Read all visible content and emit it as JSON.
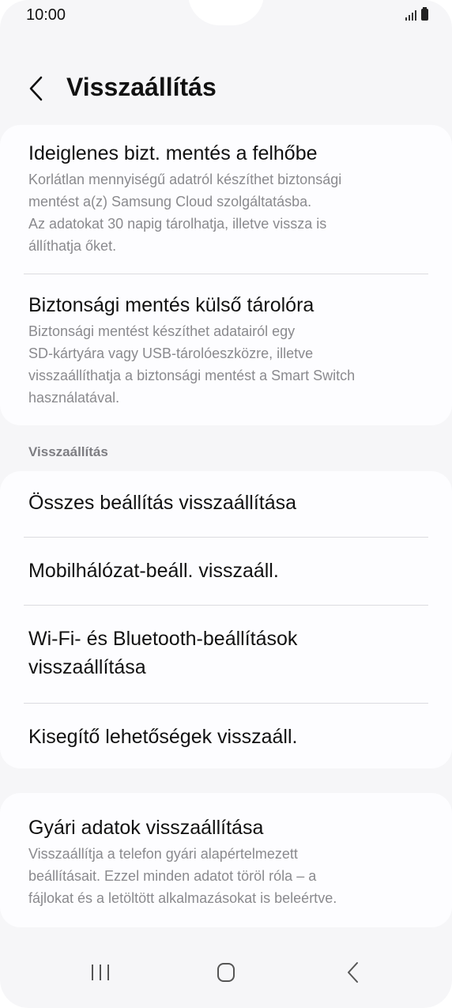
{
  "status_bar": {
    "time": "10:00"
  },
  "header": {
    "title": "Visszaállítás"
  },
  "backup_card": {
    "items": [
      {
        "title": "Ideiglenes bizt. mentés a felhőbe",
        "description_lines": [
          "Korlátlan mennyiségű adatról készíthet biztonsági",
          "mentést a(z) Samsung Cloud szolgáltatásba.",
          "Az adatokat 30 napig tárolhatja, illetve vissza is",
          "állíthatja őket."
        ]
      },
      {
        "title": "Biztonsági mentés külső tárolóra",
        "description_lines": [
          "Biztonsági mentést készíthet adatairól egy",
          "SD-kártyára vagy USB-tárolóeszközre, illetve",
          "visszaállíthatja a biztonsági mentést a Smart Switch",
          "használatával."
        ]
      }
    ]
  },
  "reset_section": {
    "header": "Visszaállítás",
    "items": [
      {
        "title_lines": [
          "Összes beállítás visszaállítása"
        ]
      },
      {
        "title_lines": [
          "Mobilhálózat-beáll. visszaáll."
        ]
      },
      {
        "title_lines": [
          "Wi-Fi- és Bluetooth-beállítások",
          "visszaállítása"
        ]
      },
      {
        "title_lines": [
          "Kisegítő lehetőségek visszaáll."
        ]
      }
    ]
  },
  "factory_card": {
    "title": "Gyári adatok visszaállítása",
    "description_lines": [
      "Visszaállítja a telefon gyári alapértelmezett",
      "beállításait. Ezzel minden adatot töröl róla – a",
      "fájlokat és a letöltött alkalmazásokat is beleértve."
    ]
  },
  "navbar": {
    "icons": [
      "recents-icon",
      "home-icon",
      "back-icon"
    ]
  }
}
